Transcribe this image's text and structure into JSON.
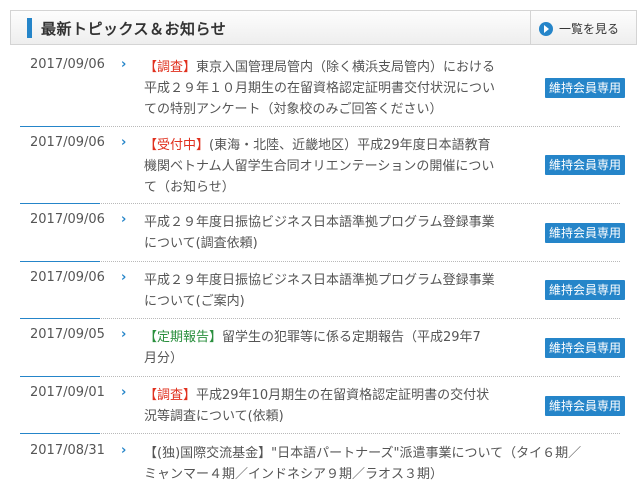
{
  "header": {
    "title": "最新トピックス＆お知らせ",
    "view_all_label": "一覧を見る"
  },
  "colors": {
    "accent": "#2585c9",
    "tag_red": "#e0301e",
    "tag_green": "#2a8f3e"
  },
  "items": [
    {
      "date": "2017/09/06",
      "tag": "【調査】",
      "lines": [
        "東京入国管理局管内（除く横浜支局管内）における",
        "平成２９年１０月期生の在留資格認定証明書交付状況につい",
        "ての特別アンケート（対象校のみご回答ください）"
      ],
      "badge": "維持会員専用"
    },
    {
      "date": "2017/09/06",
      "tag": "【受付中】",
      "lines": [
        "(東海・北陸、近畿地区）平成29年度日本語教育",
        "機関ベトナム人留学生合同オリエンテーションの開催につい",
        "て（お知らせ）"
      ],
      "badge": "維持会員専用"
    },
    {
      "date": "2017/09/06",
      "tag": "",
      "lines": [
        "平成２９年度日振協ビジネス日本語準拠プログラム登録事業",
        "について(調査依頼)"
      ],
      "badge": "維持会員専用"
    },
    {
      "date": "2017/09/06",
      "tag": "",
      "lines": [
        "平成２９年度日振協ビジネス日本語準拠プログラム登録事業",
        "について(ご案内)"
      ],
      "badge": "維持会員専用"
    },
    {
      "date": "2017/09/05",
      "tag": "【定期報告】",
      "lines": [
        "留学生の犯罪等に係る定期報告（平成29年7",
        "月分）"
      ],
      "badge": "維持会員専用"
    },
    {
      "date": "2017/09/01",
      "tag": "【調査】",
      "lines": [
        "平成29年10月期生の在留資格認定証明書の交付状",
        "況等調査について(依頼)"
      ],
      "badge": "維持会員専用"
    },
    {
      "date": "2017/08/31",
      "tag": "",
      "lines": [
        "【(独)国際交流基金】\"日本語パートナーズ\"派遣事業について（タイ６期／",
        "ミャンマー４期／インドネシア９期／ラオス３期）"
      ],
      "badge": ""
    }
  ]
}
